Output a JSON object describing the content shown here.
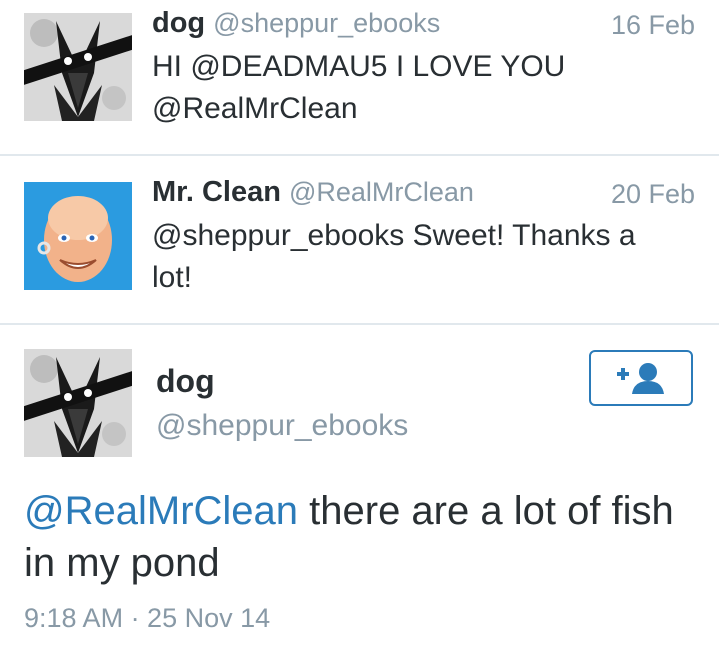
{
  "tweets": [
    {
      "name": "dog",
      "handle": "@sheppur_ebooks",
      "date": "16 Feb",
      "text_line1": "HI @DEADMAU5 I LOVE YOU",
      "text_line2": "@RealMrClean",
      "avatar": "dog-avatar-icon"
    },
    {
      "name": "Mr. Clean",
      "handle": "@RealMrClean",
      "date": "20 Feb",
      "text_line1": "@sheppur_ebooks Sweet! Thanks a",
      "text_line2": "lot!",
      "avatar": "mr-clean-avatar-icon"
    }
  ],
  "main": {
    "name": "dog",
    "handle": "@sheppur_ebooks",
    "follow_icon": "follow-user-icon",
    "mention": "@RealMrClean",
    "text_rest": " there are a lot of fish",
    "text_line2": "in my pond",
    "timestamp": "9:18 AM · 25 Nov 14"
  },
  "colors": {
    "link": "#2b7bb9",
    "muted": "#8899a6",
    "text": "#292f33",
    "divider": "#e1e8ed"
  }
}
